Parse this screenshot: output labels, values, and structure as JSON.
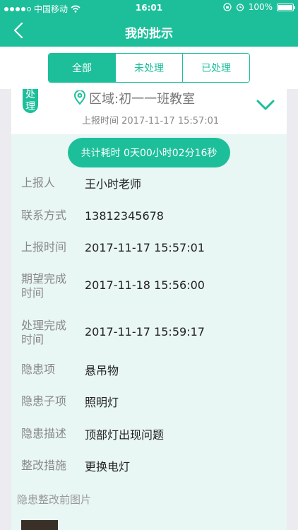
{
  "status_bar": {
    "carrier": "中国移动",
    "time": "16:01",
    "battery": "100%"
  },
  "nav": {
    "title": "我的批示"
  },
  "tabs": [
    {
      "label": "全部",
      "active": true
    },
    {
      "label": "未处理",
      "active": false
    },
    {
      "label": "已处理",
      "active": false
    }
  ],
  "card": {
    "badge": "处理",
    "region": "区域:初一一班教室",
    "report_time": "上报时间 2017-11-17 15:57:01"
  },
  "detail": {
    "total_time": "共计耗时 0天00小时02分16秒",
    "rows": [
      {
        "label": "上报人",
        "value": "王小时老师"
      },
      {
        "label": "联系方式",
        "value": "13812345678"
      },
      {
        "label": "上报时间",
        "value": "2017-11-17 15:57:01"
      },
      {
        "label": "期望完成时间",
        "value": "2017-11-18 15:56:00"
      },
      {
        "label": "处理完成时间",
        "value": "2017-11-17 15:59:17"
      },
      {
        "label": "隐患项",
        "value": "悬吊物"
      },
      {
        "label": "隐患子项",
        "value": "照明灯"
      },
      {
        "label": "隐患描述",
        "value": "顶部灯出现问题"
      },
      {
        "label": "整改措施",
        "value": "更换电灯"
      }
    ],
    "photo_label": "隐患整改前图片"
  },
  "colors": {
    "accent": "#1dbf9b",
    "detail_bg": "#e8f6f4"
  }
}
